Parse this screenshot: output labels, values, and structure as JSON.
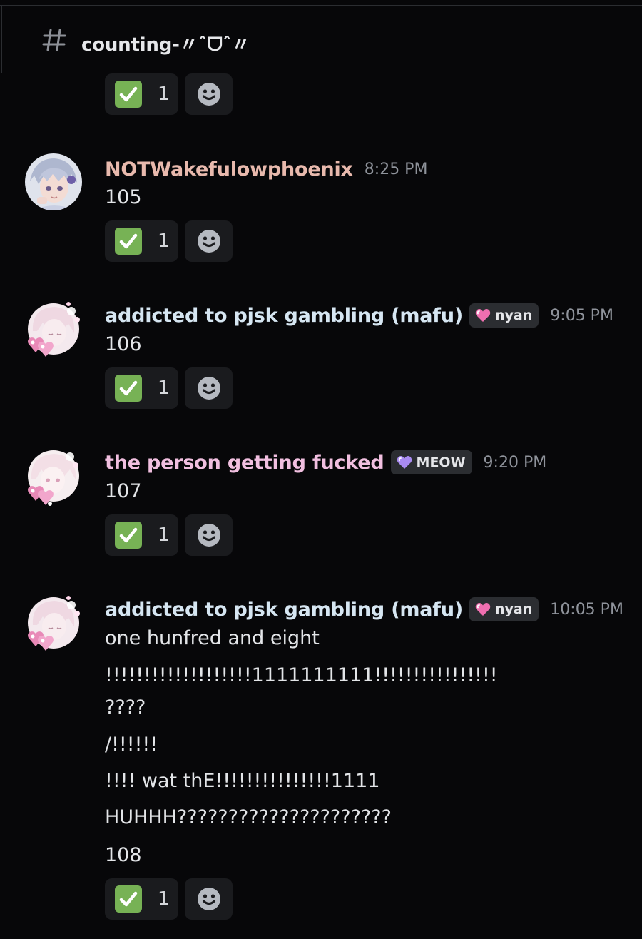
{
  "channel": {
    "name": "counting-〃ˆᗜˆ〃"
  },
  "messages": [
    {
      "id": "previous",
      "reactions": {
        "emoji": "white-check-mark",
        "count": "1"
      }
    },
    {
      "id": "m105",
      "username": "NOTWakefulowphoenix",
      "username_color": "#e8b9ad",
      "timestamp": "8:25 PM",
      "lines": [
        "105"
      ],
      "reactions": {
        "emoji": "white-check-mark",
        "count": "1"
      }
    },
    {
      "id": "m106",
      "username": "addicted to pjsk gambling (mafu)",
      "username_color": "#d6e6f2",
      "tag": {
        "label": "nyan",
        "heart_color": "#f06fb0"
      },
      "timestamp": "9:05 PM",
      "lines": [
        "106"
      ],
      "reactions": {
        "emoji": "white-check-mark",
        "count": "1"
      }
    },
    {
      "id": "m107",
      "username": "the person getting fucked",
      "username_color": "#f1bfe0",
      "tag": {
        "label": "MEOW",
        "heart_color": "#a98bf0"
      },
      "timestamp": "9:20 PM",
      "lines": [
        "107"
      ],
      "reactions": {
        "emoji": "white-check-mark",
        "count": "1"
      }
    },
    {
      "id": "m108",
      "username": "addicted to pjsk gambling (mafu)",
      "username_color": "#d6e6f2",
      "tag": {
        "label": "nyan",
        "heart_color": "#f06fb0"
      },
      "timestamp": "10:05 PM",
      "lines": [
        "one hunfred and eight",
        "!!!!!!!!!!!!!!!!!!!1111111111!!!!!!!!!!!!!!!!",
        "????",
        "/!!!!!!",
        "!!!! wat thE!!!!!!!!!!!!!!!1111",
        "HUHHH?????????????????????",
        "108"
      ],
      "reactions": {
        "emoji": "white-check-mark",
        "count": "1"
      }
    }
  ],
  "colors": {
    "background": "#070709",
    "pill": "#1a1b1e",
    "check_green": "#77b255",
    "timestamp": "#8f939b"
  }
}
